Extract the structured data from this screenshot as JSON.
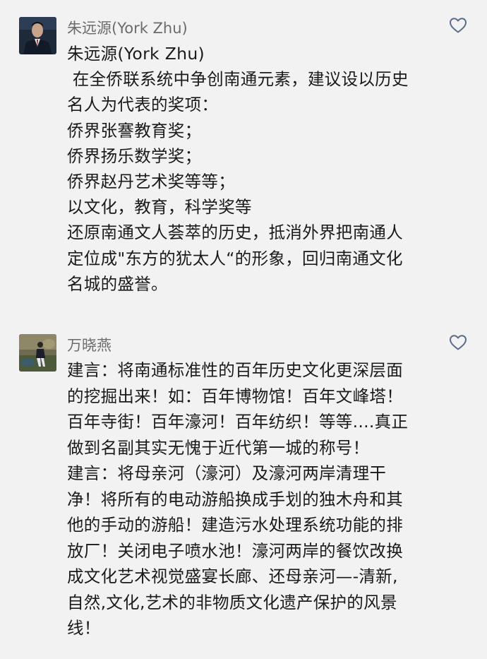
{
  "comments": [
    {
      "author": "朱远源(York Zhu)",
      "lines": [
        "朱远源(York Zhu)",
        " 在全侨联系统中争创南通元素，建议设以历史",
        "名人为代表的奖项：",
        "侨界张謇教育奖；",
        "侨界扬乐数学奖；",
        "侨界赵丹艺术奖等等；",
        "以文化，教育，科学奖等",
        "还原南通文人荟萃的历史，抵消外界把南通人",
        "定位成\"东方的犹太人“的形象，回归南通文化",
        "名城的盛誉。"
      ]
    },
    {
      "author": "万晓燕",
      "lines": [
        "建言：将南通标准性的百年历史文化更深层面",
        "的挖掘出来！如：百年博物馆！百年文峰塔！",
        "百年寺街！百年濠河！百年纺织！等等....真正",
        "做到名副其实无愧于近代第一城的称号！",
        "建言：将母亲河（濠河）及濠河两岸清理干",
        "净！将所有的电动游船换成手划的独木舟和其",
        "他的手动的游船！建造污水处理系统功能的排",
        "放厂！关闭电子喷水池！濠河两岸的餐饮改换",
        "成文化艺术视觉盛宴长廊、还母亲河—-清新,",
        "自然,文化,艺术的非物质文化遗产保护的风景",
        "线！"
      ]
    }
  ],
  "icons": {
    "like": "heart-outline-icon",
    "like_color": "#5a6b8c"
  }
}
